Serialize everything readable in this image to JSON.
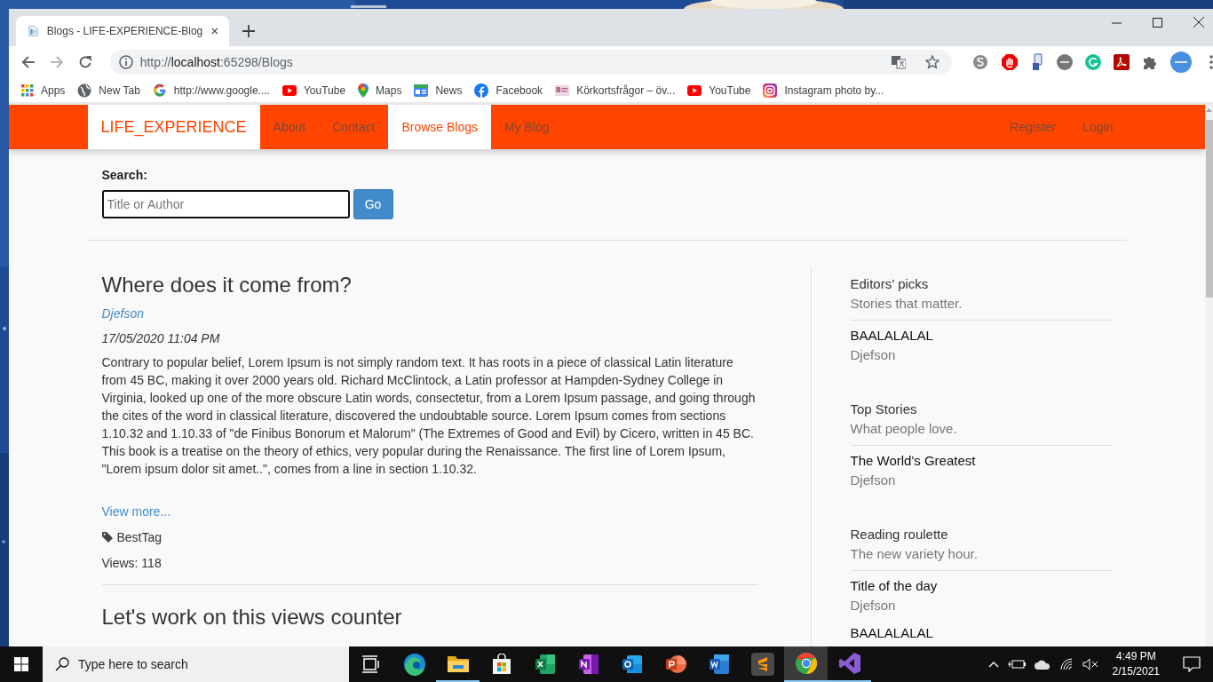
{
  "browser": {
    "tab_title": "Blogs - LIFE-EXPERIENCE-Blog",
    "address": {
      "scheme": "http://",
      "host": "localhost",
      "rest": ":65298/Blogs"
    },
    "bookmarks": [
      {
        "kind": "apps",
        "label": "Apps"
      },
      {
        "kind": "globe",
        "label": "New Tab"
      },
      {
        "kind": "google",
        "label": "http://www.google...."
      },
      {
        "kind": "youtube",
        "label": "YouTube"
      },
      {
        "kind": "maps",
        "label": "Maps"
      },
      {
        "kind": "news",
        "label": "News"
      },
      {
        "kind": "facebook",
        "label": "Facebook"
      },
      {
        "kind": "card",
        "label": "Körkortsfrågor – öv..."
      },
      {
        "kind": "youtube",
        "label": "YouTube"
      },
      {
        "kind": "instagram",
        "label": "Instagram photo by..."
      }
    ]
  },
  "site": {
    "brand": "LIFE_EXPERIENCE",
    "nav": [
      {
        "label": "About",
        "selected": false
      },
      {
        "label": "Contact",
        "selected": false
      },
      {
        "label": "Browse Blogs",
        "selected": true
      },
      {
        "label": "My Blog",
        "selected": false
      }
    ],
    "account": [
      "Register",
      "Login"
    ]
  },
  "search": {
    "label": "Search:",
    "placeholder": "Title or Author",
    "button": "Go"
  },
  "posts": [
    {
      "title": "Where does it come from?",
      "author": "Djefson",
      "date": "17/05/2020 11:04 PM",
      "body": "Contrary to popular belief, Lorem Ipsum is not simply random text. It has roots in a piece of classical Latin literature from 45 BC, making it over 2000 years old. Richard McClintock, a Latin professor at Hampden-Sydney College in Virginia, looked up one of the more obscure Latin words, consectetur, from a Lorem Ipsum passage, and going through the cites of the word in classical literature, discovered the undoubtable source. Lorem Ipsum comes from sections 1.10.32 and 1.10.33 of \"de Finibus Bonorum et Malorum\" (The Extremes of Good and Evil) by Cicero, written in 45 BC. This book is a treatise on the theory of ethics, very popular during the Renaissance. The first line of Lorem Ipsum, \"Lorem ipsum dolor sit amet..\", comes from a line in section 1.10.32.",
      "more": "View more...",
      "tag": "BestTag",
      "views": "Views: 118"
    },
    {
      "title": "Let's work on this views counter"
    }
  ],
  "sidebar": [
    {
      "heading": "Editors’ picks",
      "subheading": "Stories that matter.",
      "items": [
        {
          "title": "BAALALALAL",
          "author": "Djefson"
        }
      ]
    },
    {
      "heading": "Top Stories",
      "subheading": "What people love.",
      "items": [
        {
          "title": "The World's Greatest",
          "author": "Djefson"
        }
      ]
    },
    {
      "heading": "Reading roulette",
      "subheading": "The new variety hour.",
      "items": [
        {
          "title": "Title of the day",
          "author": "Djefson"
        },
        {
          "title": "BAALALALAL"
        }
      ]
    }
  ],
  "taskbar": {
    "search_placeholder": "Type here to search",
    "apps": [
      {
        "kind": "task-view",
        "running": false,
        "selected": false
      },
      {
        "kind": "edge",
        "running": false,
        "selected": false
      },
      {
        "kind": "explorer",
        "running": true,
        "selected": false
      },
      {
        "kind": "store",
        "running": false,
        "selected": false
      },
      {
        "kind": "excel",
        "running": false,
        "selected": false
      },
      {
        "kind": "onenote",
        "running": false,
        "selected": false
      },
      {
        "kind": "outlook",
        "running": false,
        "selected": false
      },
      {
        "kind": "powerpoint",
        "running": false,
        "selected": false
      },
      {
        "kind": "word",
        "running": false,
        "selected": false
      },
      {
        "kind": "sublime",
        "running": false,
        "selected": false
      },
      {
        "kind": "chrome",
        "running": true,
        "selected": true
      },
      {
        "kind": "visual-studio",
        "running": true,
        "selected": false
      }
    ],
    "time": "4:49 PM",
    "date": "2/15/2021"
  }
}
